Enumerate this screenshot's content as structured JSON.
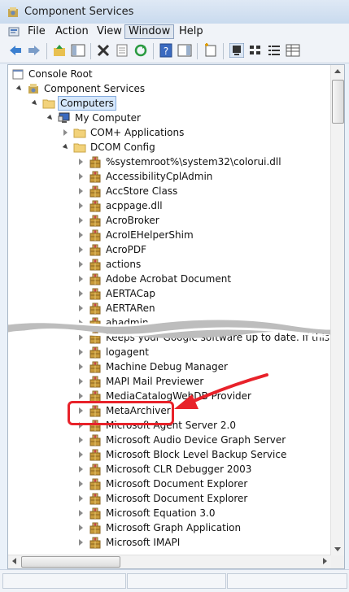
{
  "window": {
    "title": "Component Services"
  },
  "menu": [
    "File",
    "Action",
    "View",
    "Window",
    "Help"
  ],
  "menu_active": "Window",
  "tree": {
    "top": [
      {
        "label": "Console Root",
        "level": 0,
        "icon": "console-root-icon"
      },
      {
        "label": "Component Services",
        "level": 1,
        "icon": "component-services-icon"
      },
      {
        "label": "Computers",
        "level": 2,
        "icon": "folder-icon"
      },
      {
        "label": "My Computer",
        "level": 3,
        "icon": "computer-icon"
      },
      {
        "label": "COM+ Applications",
        "level": 4,
        "icon": "folder-icon"
      },
      {
        "label": "DCOM Config",
        "level": 4,
        "icon": "folder-icon"
      },
      {
        "label": "%systemroot%\\system32\\colorui.dll",
        "level": 5,
        "icon": "dcom-package-icon"
      },
      {
        "label": "AccessibilityCplAdmin",
        "level": 5,
        "icon": "dcom-package-icon"
      },
      {
        "label": "AccStore Class",
        "level": 5,
        "icon": "dcom-package-icon"
      },
      {
        "label": "acppage.dll",
        "level": 5,
        "icon": "dcom-package-icon"
      },
      {
        "label": "AcroBroker",
        "level": 5,
        "icon": "dcom-package-icon"
      },
      {
        "label": "AcroIEHelperShim",
        "level": 5,
        "icon": "dcom-package-icon"
      },
      {
        "label": "AcroPDF",
        "level": 5,
        "icon": "dcom-package-icon"
      },
      {
        "label": "actions",
        "level": 5,
        "icon": "dcom-package-icon"
      },
      {
        "label": "Adobe Acrobat Document",
        "level": 5,
        "icon": "dcom-package-icon"
      },
      {
        "label": "AERTACap",
        "level": 5,
        "icon": "dcom-package-icon"
      },
      {
        "label": "AERTARen",
        "level": 5,
        "icon": "dcom-package-icon"
      },
      {
        "label": "ahadmin",
        "level": 5,
        "icon": "dcom-package-icon"
      }
    ],
    "bottom": [
      {
        "label": "Keeps your Google software up to date. If this service",
        "level": 5,
        "icon": "dcom-package-icon"
      },
      {
        "label": "logagent",
        "level": 5,
        "icon": "dcom-package-icon"
      },
      {
        "label": "Machine Debug Manager",
        "level": 5,
        "icon": "dcom-package-icon"
      },
      {
        "label": "MAPI Mail Previewer",
        "level": 5,
        "icon": "dcom-package-icon"
      },
      {
        "label": "MediaCatalogWebDB Provider",
        "level": 5,
        "icon": "dcom-package-icon"
      },
      {
        "label": "MetaArchiver",
        "level": 5,
        "icon": "dcom-package-icon"
      },
      {
        "label": "Microsoft Agent Server 2.0",
        "level": 5,
        "icon": "dcom-package-icon"
      },
      {
        "label": "Microsoft Audio Device Graph Server",
        "level": 5,
        "icon": "dcom-package-icon"
      },
      {
        "label": "Microsoft Block Level Backup Service",
        "level": 5,
        "icon": "dcom-package-icon"
      },
      {
        "label": "Microsoft CLR Debugger 2003",
        "level": 5,
        "icon": "dcom-package-icon"
      },
      {
        "label": "Microsoft Document Explorer",
        "level": 5,
        "icon": "dcom-package-icon"
      },
      {
        "label": "Microsoft Document Explorer",
        "level": 5,
        "icon": "dcom-package-icon"
      },
      {
        "label": "Microsoft Equation 3.0",
        "level": 5,
        "icon": "dcom-package-icon"
      },
      {
        "label": "Microsoft Graph Application",
        "level": 5,
        "icon": "dcom-package-icon"
      },
      {
        "label": "Microsoft IMAPI",
        "level": 5,
        "icon": "dcom-package-icon"
      }
    ],
    "selected": "Computers",
    "highlighted": "MetaArchiver"
  },
  "colors": {
    "annotation": "#e8222a",
    "selection": "#d5e7fb"
  }
}
